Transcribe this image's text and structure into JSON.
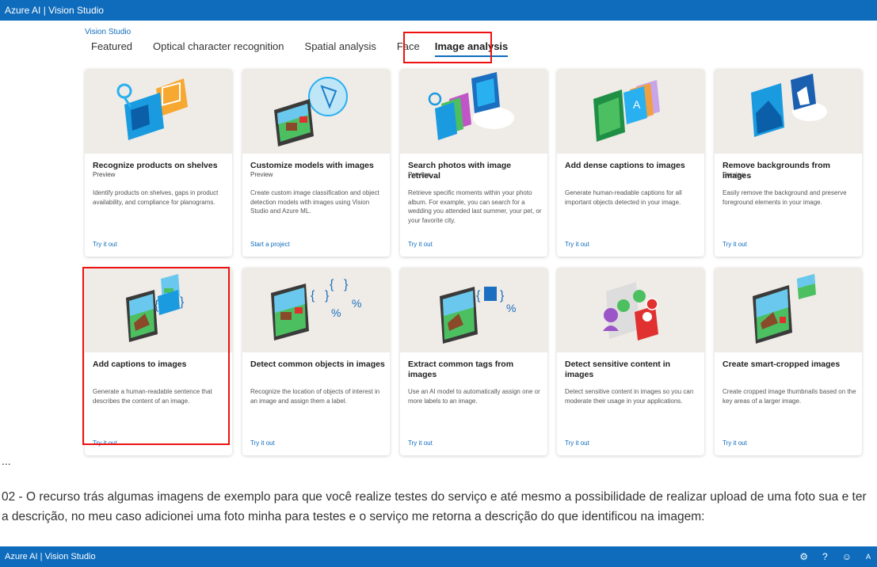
{
  "topbar": {
    "brand": "Azure AI",
    "separator": " | ",
    "product": "Vision Studio"
  },
  "breadcrumb": "Vision Studio",
  "tabs": [
    {
      "label": "Featured",
      "active": false
    },
    {
      "label": "Optical character recognition",
      "active": false
    },
    {
      "label": "Spatial analysis",
      "active": false
    },
    {
      "label": "Face",
      "active": false
    },
    {
      "label": "Image analysis",
      "active": true
    }
  ],
  "cards": [
    {
      "title": "Recognize products on shelves",
      "preview": "Preview",
      "desc": "Identify products on shelves, gaps in product availability, and compliance for planograms.",
      "link": "Try it out"
    },
    {
      "title": "Customize models with images",
      "preview": "Preview",
      "desc": "Create custom image classification and object detection models with images using Vision Studio and Azure ML.",
      "link": "Start a project"
    },
    {
      "title": "Search photos with image retrieval",
      "preview": "Preview",
      "desc": "Retrieve specific moments within your photo album. For example, you can search for a wedding you attended last summer, your pet, or your favorite city.",
      "link": "Try it out"
    },
    {
      "title": "Add dense captions to images",
      "preview": "",
      "desc": "Generate human-readable captions for all important objects detected in your image.",
      "link": "Try it out"
    },
    {
      "title": "Remove backgrounds from images",
      "preview": "Preview",
      "desc": "Easily remove the background and preserve foreground elements in your image.",
      "link": "Try it out"
    },
    {
      "title": "Add captions to images",
      "preview": "",
      "desc": "Generate a human-readable sentence that describes the content of an image.",
      "link": "Try it out"
    },
    {
      "title": "Detect common objects in images",
      "preview": "",
      "desc": "Recognize the location of objects of interest in an image and assign them a label.",
      "link": "Try it out"
    },
    {
      "title": "Extract common tags from images",
      "preview": "",
      "desc": "Use an AI model to automatically assign one or more labels to an image.",
      "link": "Try it out"
    },
    {
      "title": "Detect sensitive content in images",
      "preview": "",
      "desc": "Detect sensitive content in images so you can moderate their usage in your applications.",
      "link": "Try it out"
    },
    {
      "title": "Create smart-cropped images",
      "preview": "",
      "desc": "Create cropped image thumbnails based on the key areas of a larger image.",
      "link": "Try it out"
    }
  ],
  "ellipsis": "...",
  "paragraph": "02 - O recurso trás algumas imagens de exemplo para que você realize testes do serviço e até mesmo a possibilidade de realizar upload de uma foto sua e ter a descrição, no meu caso adicionei uma foto minha para testes e o serviço me retorna a descrição do que identificou na imagem:",
  "bottombar": {
    "brand": "Azure AI",
    "separator": " | ",
    "product": "Vision Studio",
    "icons": [
      "settings-icon",
      "help-icon",
      "feedback-icon",
      "account-icon"
    ],
    "account_initial": "A"
  },
  "colors": {
    "accent": "#0f6cbd",
    "highlight": "#e11111",
    "hero_bg": "#efebe6"
  }
}
